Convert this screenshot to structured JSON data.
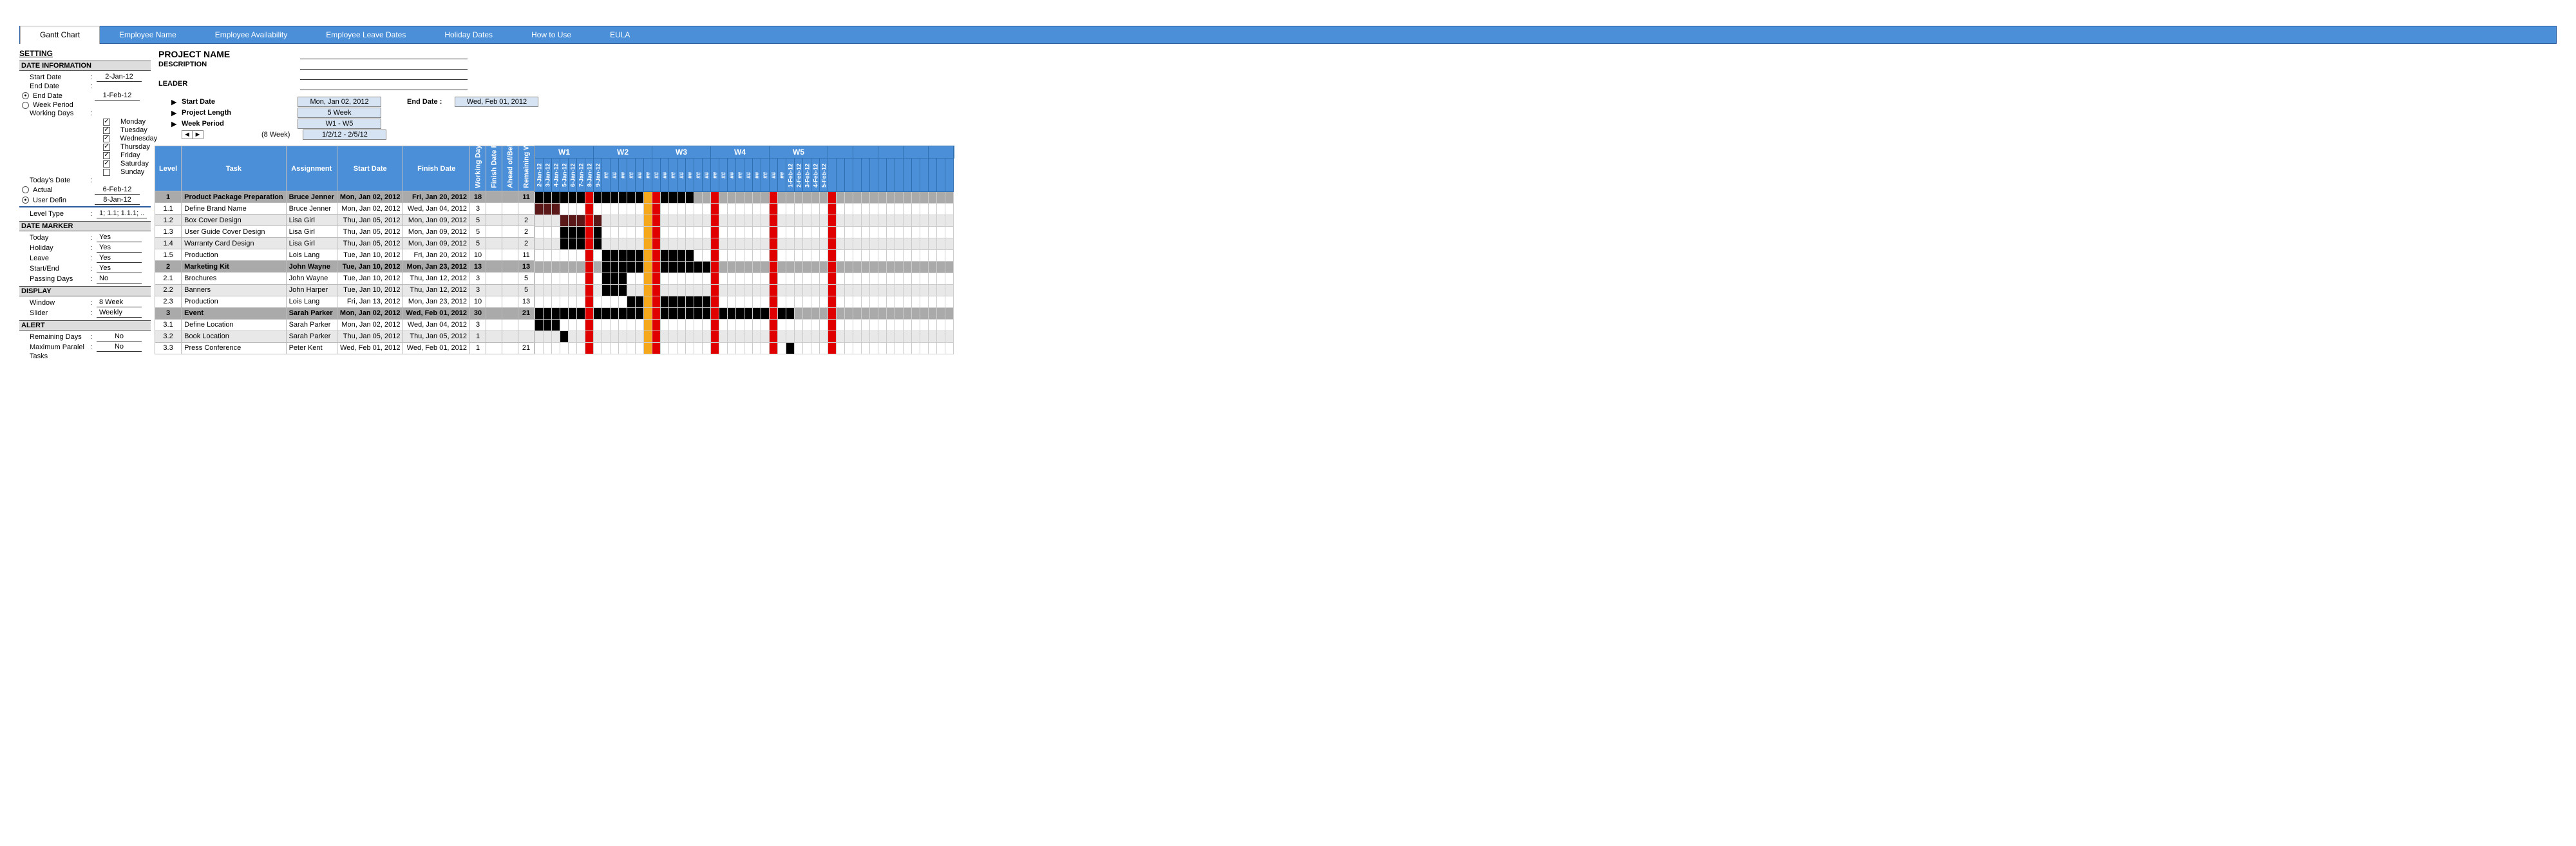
{
  "ribbon": {
    "tabs": [
      "Gantt Chart",
      "Employee Name",
      "Employee Availability",
      "Employee Leave Dates",
      "Holiday Dates",
      "How to Use",
      "EULA"
    ],
    "active": 0
  },
  "sidebar": {
    "setting": "SETTING",
    "date_info": "DATE INFORMATION",
    "start_date_label": "Start Date",
    "start_date": "2-Jan-12",
    "end_date_label": "End Date",
    "end_date_opt": "End Date",
    "end_date": "1-Feb-12",
    "week_period_opt": "Week Period",
    "working_days_label": "Working Days",
    "days": [
      "Monday",
      "Tuesday",
      "Wednesday",
      "Thursday",
      "Friday",
      "Saturday",
      "Sunday"
    ],
    "days_checked": [
      true,
      true,
      true,
      true,
      true,
      true,
      false
    ],
    "todays_date_label": "Today's Date",
    "actual_opt": "Actual",
    "actual": "6-Feb-12",
    "userdef_opt": "User Defin",
    "userdef": "8-Jan-12",
    "level_type_label": "Level Type",
    "level_type": "1; 1.1; 1.1.1; ..",
    "date_marker": "DATE MARKER",
    "today_label": "Today",
    "today_val": "Yes",
    "holiday_label": "Holiday",
    "holiday_val": "Yes",
    "leave_label": "Leave",
    "leave_val": "Yes",
    "startend_label": "Start/End",
    "startend_val": "Yes",
    "passing_label": "Passing Days",
    "passing_val": "No",
    "display": "DISPLAY",
    "window_label": "Window",
    "window_val": "8 Week",
    "slider_label": "Slider",
    "slider_val": "Weekly",
    "alert": "ALERT",
    "remaining_label": "Remaining Days",
    "remaining_val": "No",
    "maxpar_label": "Maximum Paralel",
    "maxpar_val": "No",
    "tasks_label": "Tasks"
  },
  "project": {
    "name_label": "PROJECT NAME",
    "desc_label": "DESCRIPTION",
    "leader_label": "LEADER",
    "start_date_label": "Start Date",
    "start_date": "Mon, Jan 02, 2012",
    "project_length_label": "Project Length",
    "project_length": "5 Week",
    "week_period_label": "Week Period",
    "week_period": "W1 - W5",
    "end_date_label": "End Date :",
    "end_date": "Wed, Feb 01, 2012",
    "nav_note": "(8 Week)",
    "nav_range": "1/2/12 - 2/5/12"
  },
  "table": {
    "headers": [
      "Level",
      "Task",
      "Assignment",
      "Start Date",
      "Finish Date",
      "Working Days",
      "Finish Date Realization",
      "Ahead of/Behind",
      "Remaining WD"
    ],
    "rows": [
      {
        "group": true,
        "level": "1",
        "task": "Product Package Preparation",
        "assign": "Bruce Jenner",
        "start": "Mon, Jan 02, 2012",
        "finish": "Fri, Jan 20, 2012",
        "wd": "18",
        "real": "",
        "ahead": "",
        "rem": "11"
      },
      {
        "level": "1.1",
        "task": "Define Brand Name",
        "assign": "Bruce Jenner",
        "start": "Mon, Jan 02, 2012",
        "finish": "Wed, Jan 04, 2012",
        "wd": "3",
        "real": "",
        "ahead": "",
        "rem": ""
      },
      {
        "level": "1.2",
        "task": "Box Cover Design",
        "assign": "Lisa Girl",
        "start": "Thu, Jan 05, 2012",
        "finish": "Mon, Jan 09, 2012",
        "wd": "5",
        "real": "",
        "ahead": "",
        "rem": "2"
      },
      {
        "level": "1.3",
        "task": "User Guide Cover Design",
        "assign": "Lisa Girl",
        "start": "Thu, Jan 05, 2012",
        "finish": "Mon, Jan 09, 2012",
        "wd": "5",
        "real": "",
        "ahead": "",
        "rem": "2"
      },
      {
        "level": "1.4",
        "task": "Warranty Card Design",
        "assign": "Lisa Girl",
        "start": "Thu, Jan 05, 2012",
        "finish": "Mon, Jan 09, 2012",
        "wd": "5",
        "real": "",
        "ahead": "",
        "rem": "2"
      },
      {
        "level": "1.5",
        "task": "Production",
        "assign": "Lois Lang",
        "start": "Tue, Jan 10, 2012",
        "finish": "Fri, Jan 20, 2012",
        "wd": "10",
        "real": "",
        "ahead": "",
        "rem": "11"
      },
      {
        "group": true,
        "level": "2",
        "task": "Marketing Kit",
        "assign": "John Wayne",
        "start": "Tue, Jan 10, 2012",
        "finish": "Mon, Jan 23, 2012",
        "wd": "13",
        "real": "",
        "ahead": "",
        "rem": "13"
      },
      {
        "level": "2.1",
        "task": "Brochures",
        "assign": "John Wayne",
        "start": "Tue, Jan 10, 2012",
        "finish": "Thu, Jan 12, 2012",
        "wd": "3",
        "real": "",
        "ahead": "",
        "rem": "5"
      },
      {
        "level": "2.2",
        "task": "Banners",
        "assign": "John Harper",
        "start": "Tue, Jan 10, 2012",
        "finish": "Thu, Jan 12, 2012",
        "wd": "3",
        "real": "",
        "ahead": "",
        "rem": "5"
      },
      {
        "level": "2.3",
        "task": "Production",
        "assign": "Lois Lang",
        "start": "Fri, Jan 13, 2012",
        "finish": "Mon, Jan 23, 2012",
        "wd": "10",
        "real": "",
        "ahead": "",
        "rem": "13"
      },
      {
        "group": true,
        "level": "3",
        "task": "Event",
        "assign": "Sarah Parker",
        "start": "Mon, Jan 02, 2012",
        "finish": "Wed, Feb 01, 2012",
        "wd": "30",
        "real": "",
        "ahead": "",
        "rem": "21"
      },
      {
        "level": "3.1",
        "task": "Define Location",
        "assign": "Sarah Parker",
        "start": "Mon, Jan 02, 2012",
        "finish": "Wed, Jan 04, 2012",
        "wd": "3",
        "real": "",
        "ahead": "",
        "rem": ""
      },
      {
        "level": "3.2",
        "task": "Book Location",
        "assign": "Sarah Parker",
        "start": "Thu, Jan 05, 2012",
        "finish": "Thu, Jan 05, 2012",
        "wd": "1",
        "real": "",
        "ahead": "",
        "rem": ""
      },
      {
        "level": "3.3",
        "task": "Press Conference",
        "assign": "Peter Kent",
        "start": "Wed, Feb 01, 2012",
        "finish": "Wed, Feb 01, 2012",
        "wd": "1",
        "real": "",
        "ahead": "",
        "rem": "21"
      }
    ]
  },
  "timeline": {
    "weeks": [
      "W1",
      "W2",
      "W3",
      "W4",
      "W5",
      "",
      "",
      "",
      "",
      "",
      ""
    ],
    "days": [
      "2-Jan-12",
      "3-Jan-12",
      "4-Jan-12",
      "5-Jan-12",
      "6-Jan-12",
      "7-Jan-12",
      "8-Jan-12",
      "9-Jan-12",
      "##",
      "##",
      "##",
      "##",
      "##",
      "##",
      "##",
      "##",
      "##",
      "##",
      "##",
      "##",
      "##",
      "##",
      "##",
      "##",
      "##",
      "##",
      "##",
      "##",
      "##",
      "##",
      "1-Feb-12",
      "2-Feb-12",
      "3-Feb-12",
      "4-Feb-12",
      "5-Feb-12"
    ],
    "marker_cols": {
      "red": [
        6,
        14,
        21,
        28,
        35
      ],
      "orange": [
        13
      ]
    },
    "bars": [
      {
        "row": 0,
        "start": 0,
        "end": 18
      },
      {
        "row": 1,
        "start": 0,
        "end": 2,
        "dk": true
      },
      {
        "row": 2,
        "start": 3,
        "end": 7,
        "dk": true
      },
      {
        "row": 3,
        "start": 3,
        "end": 7
      },
      {
        "row": 4,
        "start": 3,
        "end": 7
      },
      {
        "row": 5,
        "start": 8,
        "end": 18
      },
      {
        "row": 6,
        "start": 8,
        "end": 21
      },
      {
        "row": 7,
        "start": 8,
        "end": 10
      },
      {
        "row": 8,
        "start": 8,
        "end": 10
      },
      {
        "row": 9,
        "start": 11,
        "end": 21
      },
      {
        "row": 10,
        "start": 0,
        "end": 30
      },
      {
        "row": 11,
        "start": 0,
        "end": 2
      },
      {
        "row": 12,
        "start": 3,
        "end": 3
      },
      {
        "row": 13,
        "start": 30,
        "end": 30
      }
    ]
  }
}
